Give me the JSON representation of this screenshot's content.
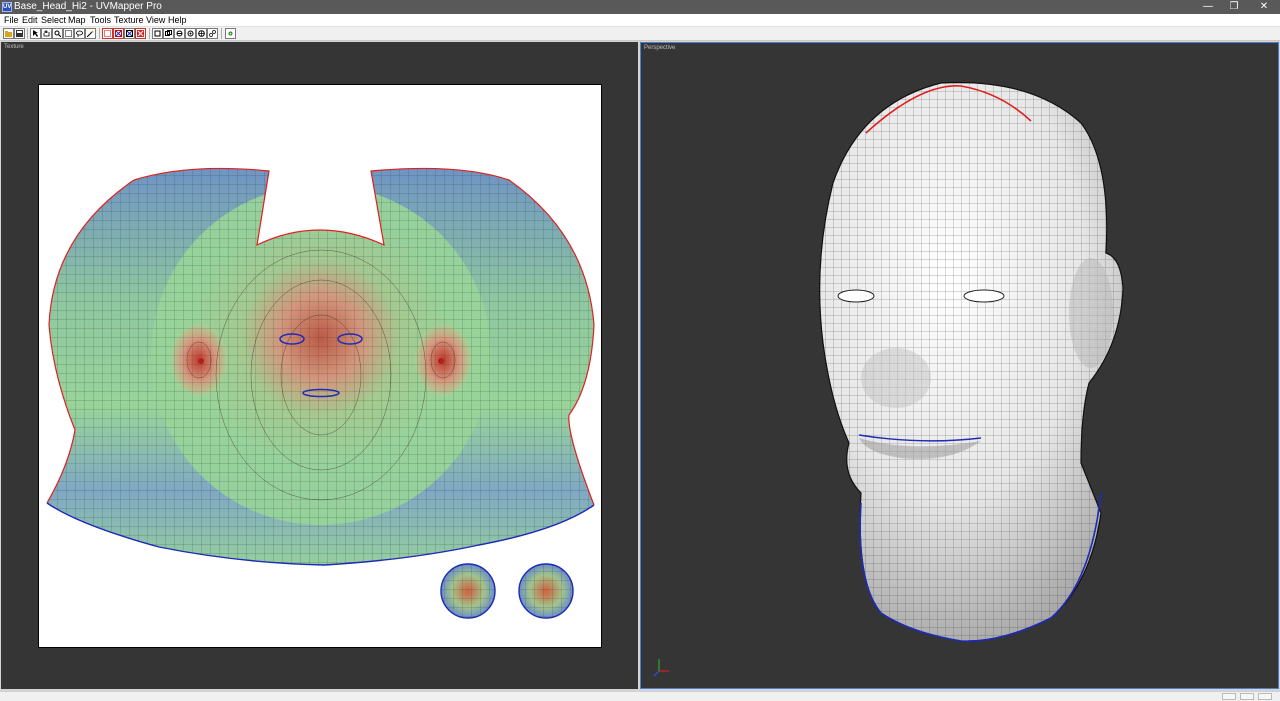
{
  "window": {
    "title": "Base_Head_Hi2 - UVMapper Pro",
    "app_icon": "UV"
  },
  "menu": [
    "File",
    "Edit",
    "Select",
    "Map",
    "Tools",
    "Texture",
    "View",
    "Help"
  ],
  "toolbar": {
    "tools": [
      "open-icon",
      "save-icon",
      "select-arrow-icon",
      "hand-pan-icon",
      "zoom-icon",
      "marquee-select-icon",
      "lasso-icon",
      "magic-wand-icon",
      "select-vertex-icon",
      "select-edge-icon",
      "select-face-icon",
      "select-group-icon",
      "flip-horizontal-icon",
      "flip-vertical-icon",
      "rotate-icon",
      "scale-icon",
      "move-icon",
      "relax-icon",
      "settings-icon"
    ]
  },
  "panels": {
    "texture_label": "Texture",
    "perspective_label": "Perspective"
  },
  "colors": {
    "uv_low_stretch": "#98d49a",
    "uv_mid": "#6b9fc2",
    "uv_high_stretch": "#c0503d",
    "seam_red": "#e02020",
    "seam_blue": "#1e2ab8",
    "viewport_bg": "#353535",
    "mesh_gray": "#e8e8e8"
  }
}
